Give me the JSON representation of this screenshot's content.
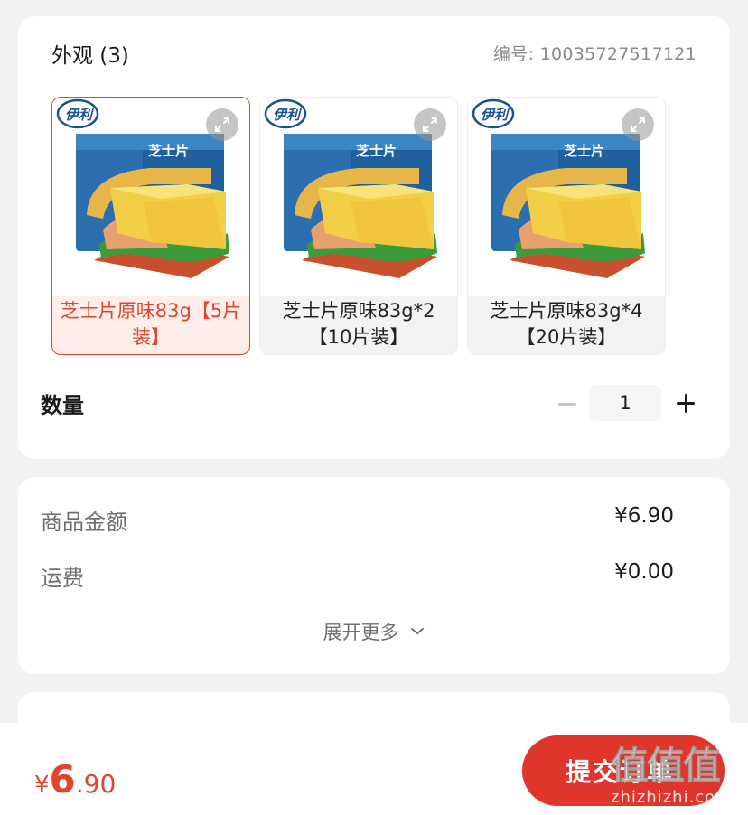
{
  "spec": {
    "title": "外观 (3)",
    "code_label": "编号:",
    "code_value": "10035727517121",
    "variants": [
      {
        "label": "芝士片原味83g【5片装】",
        "brand": "伊利",
        "package_text": "芝士片",
        "selected": true
      },
      {
        "label": "芝士片原味83g*2【10片装】",
        "brand": "伊利",
        "package_text": "芝士片",
        "selected": false
      },
      {
        "label": "芝士片原味83g*4【20片装】",
        "brand": "伊利",
        "package_text": "芝士片",
        "selected": false
      }
    ],
    "quantity_label": "数量",
    "quantity_value": "1"
  },
  "price_summary": {
    "goods_label": "商品金额",
    "goods_value": "¥6.90",
    "shipping_label": "运费",
    "shipping_value": "¥0.00",
    "expand_label": "展开更多"
  },
  "bottom_bar": {
    "total_yen": "¥",
    "total_integer": "6",
    "total_decimal": ".90",
    "submit_label": "提交订单"
  },
  "watermark": {
    "logo": "值值值",
    "url": "zhizhizhi.com"
  },
  "icons": {
    "zoom": "expand-arrows-icon",
    "minus": "minus-icon",
    "plus": "plus-icon",
    "chevron": "chevron-down-icon"
  },
  "colors": {
    "accent": "#e2452f",
    "button": "#e0352b",
    "card_bg": "#ffffff",
    "page_bg": "#f2f2f2"
  }
}
